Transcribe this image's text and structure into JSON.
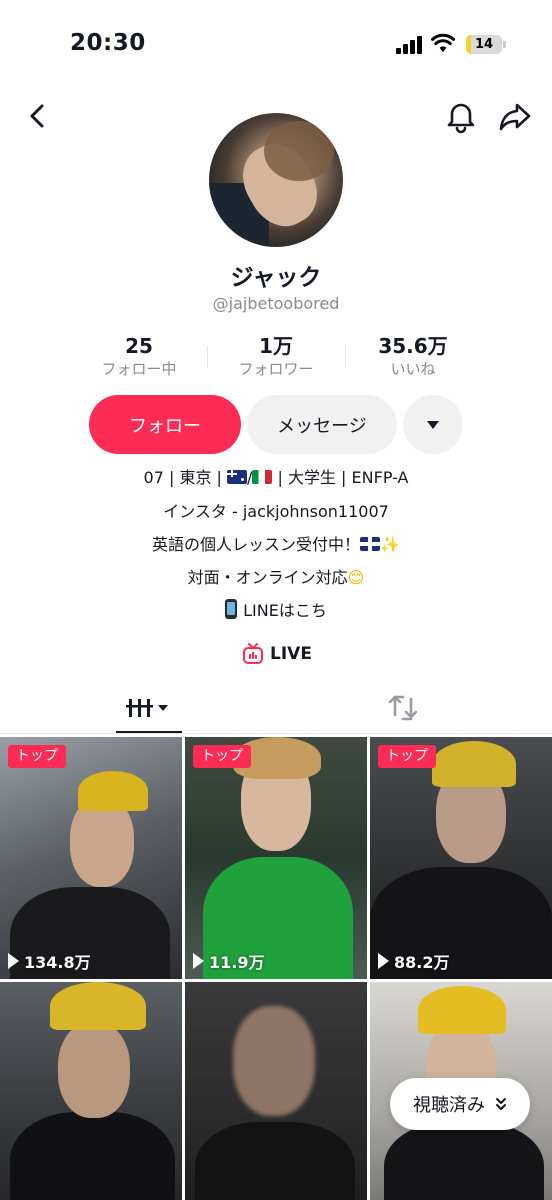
{
  "status_bar": {
    "time": "20:30",
    "battery": "14",
    "battery_level": 0.14
  },
  "profile": {
    "name": "ジャック",
    "handle": "@jajbetoobored"
  },
  "stats": [
    {
      "value": "25",
      "label": "フォロー中"
    },
    {
      "value": "1万",
      "label": "フォロワー"
    },
    {
      "value": "35.6万",
      "label": "いいね"
    }
  ],
  "actions": {
    "follow": "フォロー",
    "message": "メッセージ"
  },
  "bio": {
    "line1_a": "07 | 東京 | ",
    "line1_sep": "/",
    "line1_b": " | 大学生 | ENFP-A",
    "line2": "インスタ - jackjohnson11007",
    "line3": "英語の個人レッスン受付中！",
    "line3_emoji": "✨",
    "line4": "対面・オンライン対応",
    "line4_emoji": "😊",
    "line5": "LINEはこち"
  },
  "live": {
    "label": "LIVE"
  },
  "videos": [
    {
      "badge": "トップ",
      "views": "134.8万"
    },
    {
      "badge": "トップ",
      "views": "11.9万"
    },
    {
      "badge": "トップ",
      "views": "88.2万"
    },
    {
      "badge": "",
      "views": ""
    },
    {
      "badge": "",
      "views": ""
    },
    {
      "badge": "",
      "views": ""
    }
  ],
  "watched_pill": {
    "label": "視聴済み"
  },
  "colors": {
    "accent": "#fe2c55",
    "secondary_bg": "#f1f1f2",
    "muted_text": "#8a8b91"
  }
}
